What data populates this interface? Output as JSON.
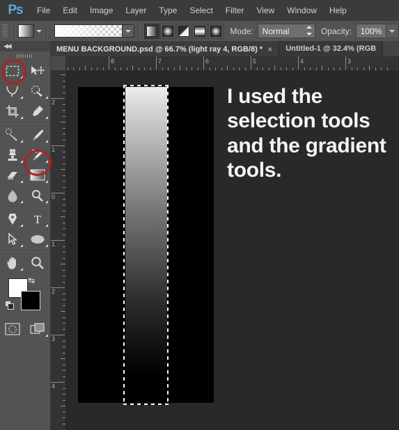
{
  "app": {
    "name": "Ps",
    "logo_color": "#5da8de"
  },
  "menubar": {
    "items": [
      {
        "label": "File"
      },
      {
        "label": "Edit"
      },
      {
        "label": "Image"
      },
      {
        "label": "Layer"
      },
      {
        "label": "Type"
      },
      {
        "label": "Select"
      },
      {
        "label": "Filter"
      },
      {
        "label": "View"
      },
      {
        "label": "Window"
      },
      {
        "label": "Help"
      }
    ]
  },
  "options_bar": {
    "gradient_swatch_icon": "gradient-swatch",
    "gradient_preset": "white-to-transparent",
    "gradient_types": [
      {
        "name": "linear-gradient",
        "active": true
      },
      {
        "name": "radial-gradient",
        "active": false
      },
      {
        "name": "angle-gradient",
        "active": false
      },
      {
        "name": "reflected-gradient",
        "active": false
      },
      {
        "name": "diamond-gradient",
        "active": false
      }
    ],
    "mode_label": "Mode:",
    "mode_value": "Normal",
    "opacity_label": "Opacity:",
    "opacity_value": "100%"
  },
  "tabs": [
    {
      "title": "MENU BACKGROUND.psd @ 66.7% (light ray 4, RGB/8) *",
      "close": "×",
      "active": true
    },
    {
      "title": "Untitled-1 @ 32.4% (RGB",
      "active": false
    }
  ],
  "rulers": {
    "horizontal_labels": [
      "8",
      "7",
      "6",
      "5",
      "4",
      "3"
    ],
    "vertical_labels": [
      "2",
      "1",
      "0",
      "1",
      "2",
      "3",
      "4"
    ],
    "unit": "inches"
  },
  "toolbar": {
    "collapse_icon": "double-chevron-left-icon",
    "tools": [
      {
        "name": "rectangular-marquee-tool",
        "highlighted": true,
        "has_flyout": true
      },
      {
        "name": "move-tool",
        "highlighted": false,
        "has_flyout": false
      },
      {
        "name": "lasso-tool",
        "highlighted": false,
        "has_flyout": true
      },
      {
        "name": "quick-selection-tool",
        "highlighted": false,
        "has_flyout": true
      },
      {
        "name": "crop-tool",
        "highlighted": false,
        "has_flyout": true
      },
      {
        "name": "eyedropper-tool",
        "highlighted": false,
        "has_flyout": true
      },
      {
        "name": "spot-healing-brush-tool",
        "highlighted": false,
        "has_flyout": true
      },
      {
        "name": "brush-tool",
        "highlighted": false,
        "has_flyout": true
      },
      {
        "name": "clone-stamp-tool",
        "highlighted": false,
        "has_flyout": true
      },
      {
        "name": "history-brush-tool",
        "highlighted": false,
        "has_flyout": true
      },
      {
        "name": "eraser-tool",
        "highlighted": false,
        "has_flyout": true
      },
      {
        "name": "gradient-tool",
        "highlighted": true,
        "has_flyout": true
      },
      {
        "name": "blur-tool",
        "highlighted": false,
        "has_flyout": true
      },
      {
        "name": "dodge-tool",
        "highlighted": false,
        "has_flyout": true
      },
      {
        "name": "pen-tool",
        "highlighted": false,
        "has_flyout": true
      },
      {
        "name": "horizontal-type-tool",
        "highlighted": false,
        "has_flyout": true
      },
      {
        "name": "path-selection-tool",
        "highlighted": false,
        "has_flyout": true
      },
      {
        "name": "ellipse-shape-tool",
        "highlighted": false,
        "has_flyout": true
      },
      {
        "name": "hand-tool",
        "highlighted": false,
        "has_flyout": true
      },
      {
        "name": "zoom-tool",
        "highlighted": false,
        "has_flyout": false
      }
    ],
    "foreground_color": "#ffffff",
    "background_color": "#000000",
    "swap_icon": "swap-colors-icon",
    "default_colors_icon": "default-colors-icon",
    "quick_mask_icon": "quick-mask-icon",
    "screen_mode_icon": "screen-mode-icon",
    "highlight_color": "#b02020"
  },
  "canvas": {
    "document_background": "#000000",
    "gradient_from": "#ededed",
    "gradient_to": "#000000",
    "selection_style": "marching-ants",
    "annotation_text": "I used the selection tools and the gradient tools."
  }
}
